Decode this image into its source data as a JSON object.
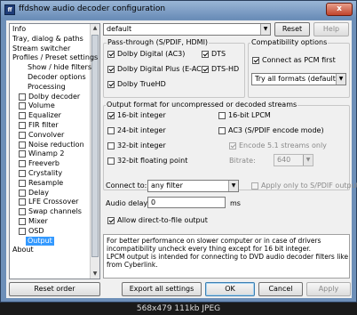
{
  "window": {
    "title": "ffdshow audio decoder configuration",
    "close_glyph": "x",
    "icon_text": "ff"
  },
  "tree": {
    "items": [
      {
        "label": "Info",
        "indent": 0,
        "checkbox": false
      },
      {
        "label": "Tray, dialog & paths",
        "indent": 0,
        "checkbox": false
      },
      {
        "label": "Stream switcher",
        "indent": 0,
        "checkbox": false
      },
      {
        "label": "Profiles / Preset settings",
        "indent": 0,
        "checkbox": false
      },
      {
        "label": "Show / hide filters",
        "indent": 2,
        "checkbox": false
      },
      {
        "label": "Decoder options",
        "indent": 2,
        "checkbox": false
      },
      {
        "label": "Processing",
        "indent": 2,
        "checkbox": false
      },
      {
        "label": "Dolby decoder",
        "indent": 1,
        "checkbox": true,
        "checked": false
      },
      {
        "label": "Volume",
        "indent": 1,
        "checkbox": true,
        "checked": false
      },
      {
        "label": "Equalizer",
        "indent": 1,
        "checkbox": true,
        "checked": false
      },
      {
        "label": "FIR filter",
        "indent": 1,
        "checkbox": true,
        "checked": false
      },
      {
        "label": "Convolver",
        "indent": 1,
        "checkbox": true,
        "checked": false
      },
      {
        "label": "Noise reduction",
        "indent": 1,
        "checkbox": true,
        "checked": false
      },
      {
        "label": "Winamp 2",
        "indent": 1,
        "checkbox": true,
        "checked": false
      },
      {
        "label": "Freeverb",
        "indent": 1,
        "checkbox": true,
        "checked": false
      },
      {
        "label": "Crystality",
        "indent": 1,
        "checkbox": true,
        "checked": false
      },
      {
        "label": "Resample",
        "indent": 1,
        "checkbox": true,
        "checked": false
      },
      {
        "label": "Delay",
        "indent": 1,
        "checkbox": true,
        "checked": false
      },
      {
        "label": "LFE Crossover",
        "indent": 1,
        "checkbox": true,
        "checked": false
      },
      {
        "label": "Swap channels",
        "indent": 1,
        "checkbox": true,
        "checked": false
      },
      {
        "label": "Mixer",
        "indent": 1,
        "checkbox": true,
        "checked": false
      },
      {
        "label": "OSD",
        "indent": 1,
        "checkbox": true,
        "checked": false
      },
      {
        "label": "Output",
        "indent": 1,
        "checkbox": false,
        "selected": true
      },
      {
        "label": "About",
        "indent": 0,
        "checkbox": false
      }
    ],
    "reset_order_label": "Reset order"
  },
  "preset": {
    "value": "default",
    "reset_label": "Reset",
    "help_label": "Help"
  },
  "passthrough": {
    "title": "Pass-through (S/PDIF, HDMI)",
    "options": [
      {
        "label": "Dolby Digital (AC3)",
        "checked": true
      },
      {
        "label": "DTS",
        "checked": true
      },
      {
        "label": "Dolby Digital Plus (E-AC3)",
        "checked": true
      },
      {
        "label": "DTS-HD",
        "checked": true
      },
      {
        "label": "Dolby TrueHD",
        "checked": true
      }
    ]
  },
  "compat": {
    "title": "Compatibility options",
    "pcm_label": "Connect as PCM first",
    "pcm_checked": true,
    "formats_value": "Try all formats (default)"
  },
  "output_format": {
    "title": "Output format for uncompressed or decoded streams",
    "options": [
      {
        "label": "16-bit integer",
        "checked": true
      },
      {
        "label": "16-bit LPCM",
        "checked": false
      },
      {
        "label": "24-bit integer",
        "checked": false
      },
      {
        "label": "AC3 (S/PDIF encode mode)",
        "checked": false
      },
      {
        "label": "32-bit integer",
        "checked": false
      },
      {
        "label": "Encode 5.1 streams only",
        "checked": true,
        "disabled": true
      },
      {
        "label": "32-bit floating point",
        "checked": false
      }
    ],
    "bitrate_label": "Bitrate:",
    "bitrate_value": "640"
  },
  "connect": {
    "label": "Connect to:",
    "value": "any filter",
    "spdif_only_label": "Apply only to S/PDIF output",
    "spdif_only_checked": false
  },
  "delay": {
    "label": "Audio delay:",
    "value": "0",
    "unit": "ms"
  },
  "direct_file": {
    "label": "Allow direct-to-file output",
    "checked": true
  },
  "info_lines": [
    "For better performance on slower computer or in case of drivers",
    "incompatibility uncheck every thing except for 16 bit integer.",
    "LPCM output is intended for connecting to DVD audio decoder filters like one",
    "from Cyberlink."
  ],
  "buttons": {
    "export": "Export all settings",
    "ok": "OK",
    "cancel": "Cancel",
    "apply": "Apply"
  },
  "status": "568x479  111kb  JPEG",
  "colors": {
    "selection": "#3399ff",
    "title_gradient_top": "#9ab6d6",
    "close": "#c0432b"
  }
}
